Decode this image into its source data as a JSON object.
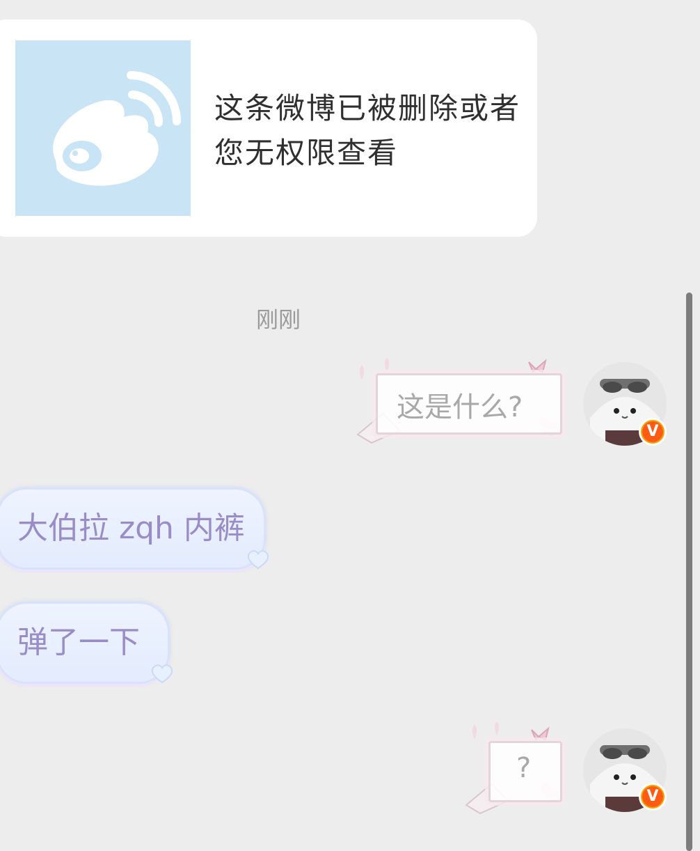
{
  "shared_post": {
    "message": "这条微博已被删除或者您无权限查看",
    "thumbnail_icon": "weibo-logo-icon"
  },
  "timestamp": "刚刚",
  "messages": [
    {
      "direction": "sent",
      "text": "这是什么?"
    },
    {
      "direction": "received",
      "text": "大伯拉 zqh 内裤"
    },
    {
      "direction": "received",
      "text": "弹了一下"
    },
    {
      "direction": "sent",
      "text": "?"
    }
  ],
  "user": {
    "verified_badge": "V"
  },
  "colors": {
    "background": "#ededed",
    "thumbnail_bg": "#c8e4f5",
    "received_text": "#9a8cc6",
    "badge": "#ff5b14"
  }
}
